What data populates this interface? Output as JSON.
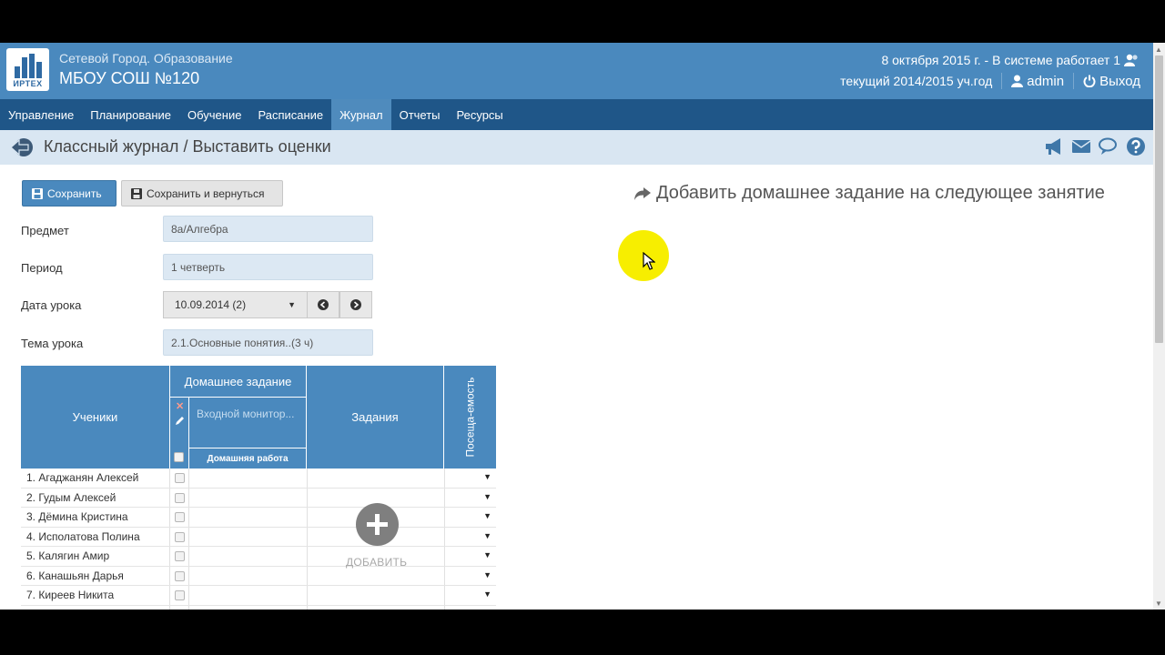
{
  "header": {
    "logo_text": "ИРТЕХ",
    "brand_sub": "Сетевой Город. Образование",
    "brand_title": "МБОУ СОШ №120",
    "status_line": "8 октября 2015 г. - В системе работает 1",
    "year_line": "текущий 2014/2015 уч.год",
    "user_label": "admin",
    "logout_label": "Выход"
  },
  "nav": {
    "items": [
      "Управление",
      "Планирование",
      "Обучение",
      "Расписание",
      "Журнал",
      "Отчеты",
      "Ресурсы"
    ],
    "active": "Журнал"
  },
  "page": {
    "title": "Классный журнал / Выставить оценки"
  },
  "toolbar": {
    "save_label": "Сохранить",
    "save_return_label": "Сохранить и вернуться"
  },
  "add_homework_link": "Добавить домашнее задание на следующее занятие",
  "form": {
    "subject_label": "Предмет",
    "subject_value": "8а/Алгебра",
    "period_label": "Период",
    "period_value": "1 четверть",
    "date_label": "Дата урока",
    "date_value": "10.09.2014 (2)",
    "topic_label": "Тема урока",
    "topic_value": "2.1.Основные понятия..(3 ч)"
  },
  "table": {
    "col_students": "Ученики",
    "col_homework": "Домашнее задание",
    "homework_task": "Входной монитор...",
    "homework_type": "Домашняя работа",
    "col_tasks": "Задания",
    "col_attendance": "Посеща-емость",
    "add_label": "ДОБАВИТЬ",
    "students": [
      "1. Агаджанян Алексей",
      "2. Гудым Алексей",
      "3. Дёмина Кристина",
      "4. Исполатова Полина",
      "5. Калягин Амир",
      "6. Канашьян Дарья",
      "7. Киреев Никита"
    ]
  },
  "colors": {
    "header_bg": "#4a89be",
    "nav_bg": "#1f5688",
    "title_bar_bg": "#d9e6f2",
    "field_bg": "#dce8f3",
    "cursor_highlight": "#f7ee00"
  }
}
